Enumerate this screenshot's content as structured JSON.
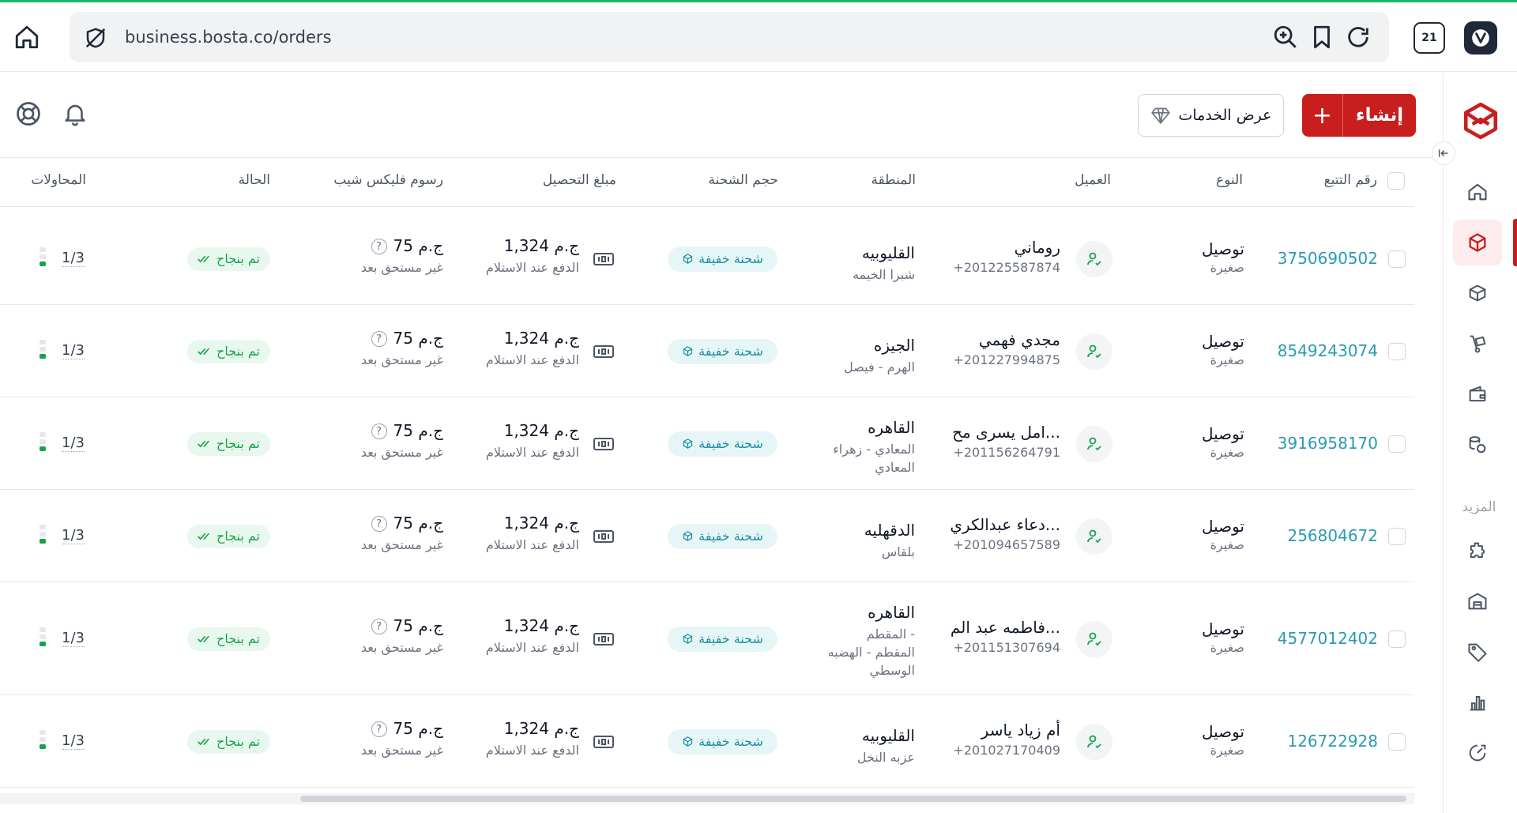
{
  "browser": {
    "url": "business.bosta.co/orders",
    "tabs_count": "21"
  },
  "header": {
    "create_label": "إنشاء",
    "create_plus": "+",
    "services_label": "عرض الخدمات"
  },
  "sidebar": {
    "more_label": "المزيد",
    "items": [
      {
        "icon": "home-icon"
      },
      {
        "icon": "package-icon",
        "active": true
      },
      {
        "icon": "boxes-icon"
      },
      {
        "icon": "hand-truck-icon"
      },
      {
        "icon": "wallet-icon"
      },
      {
        "icon": "coins-icon"
      },
      {
        "icon": "puzzle-icon"
      },
      {
        "icon": "warehouse-icon"
      },
      {
        "icon": "tag-icon"
      },
      {
        "icon": "analytics-icon"
      },
      {
        "icon": "speedometer-icon"
      }
    ]
  },
  "table": {
    "columns": {
      "tracking": "رقم التتبع",
      "type": "النوع",
      "customer": "العميل",
      "region": "المنطقة",
      "size": "حجم الشحنة",
      "cod": "مبلغ التحصيل",
      "fees": "رسوم فليكس شيب",
      "status": "الحالة",
      "attempts": "المحاولات"
    },
    "rows": [
      {
        "tracking": "3750690502",
        "type": "توصيل",
        "type_sub": "صغيرة",
        "name": "روماني",
        "phone": "+201225587874",
        "city": "القليوبيه",
        "area": "شبرا الخيمه",
        "size": "شحنة خفيفة",
        "cod": "1,324 ج.م",
        "cod_sub": "الدفع عند الاستلام",
        "fee": "75 ج.م",
        "fee_sub": "غير مستحق بعد",
        "status": "تم بنجاح",
        "attempts": "1/3"
      },
      {
        "tracking": "8549243074",
        "type": "توصيل",
        "type_sub": "صغيرة",
        "name": "مجدي فهمي",
        "phone": "+201227994875",
        "city": "الجيزه",
        "area": "الهرم - فيصل",
        "size": "شحنة خفيفة",
        "cod": "1,324 ج.م",
        "cod_sub": "الدفع عند الاستلام",
        "fee": "75 ج.م",
        "fee_sub": "غير مستحق بعد",
        "status": "تم بنجاح",
        "attempts": "1/3"
      },
      {
        "tracking": "3916958170",
        "type": "توصيل",
        "type_sub": "صغيرة",
        "name": "امل يسرى مح...",
        "phone": "+201156264791",
        "city": "القاهره",
        "area": "المعادي - زهراء",
        "area2": "المعادي",
        "size": "شحنة خفيفة",
        "cod": "1,324 ج.م",
        "cod_sub": "الدفع عند الاستلام",
        "fee": "75 ج.م",
        "fee_sub": "غير مستحق بعد",
        "status": "تم بنجاح",
        "attempts": "1/3"
      },
      {
        "tracking": "256804672",
        "type": "توصيل",
        "type_sub": "صغيرة",
        "name": "دعاء عبدالكري...",
        "phone": "+201094657589",
        "city": "الدقهليه",
        "area": "بلقاس",
        "size": "شحنة خفيفة",
        "cod": "1,324 ج.م",
        "cod_sub": "الدفع عند الاستلام",
        "fee": "75 ج.م",
        "fee_sub": "غير مستحق بعد",
        "status": "تم بنجاح",
        "attempts": "1/3"
      },
      {
        "tracking": "4577012402",
        "type": "توصيل",
        "type_sub": "صغيرة",
        "name": "فاطمه عبد الم...",
        "phone": "+201151307694",
        "city": "القاهره",
        "area": "المقطم -",
        "area2": "المقطم - الهضبه",
        "area3": "الوسطي",
        "size": "شحنة خفيفة",
        "cod": "1,324 ج.م",
        "cod_sub": "الدفع عند الاستلام",
        "fee": "75 ج.م",
        "fee_sub": "غير مستحق بعد",
        "status": "تم بنجاح",
        "attempts": "1/3"
      },
      {
        "tracking": "126722928",
        "type": "توصيل",
        "type_sub": "صغيرة",
        "name": "أم زياد ياسر",
        "phone": "+201027170409",
        "city": "القليوبيه",
        "area": "عزبه النخل",
        "size": "شحنة خفيفة",
        "cod": "1,324 ج.م",
        "cod_sub": "الدفع عند الاستلام",
        "fee": "75 ج.م",
        "fee_sub": "غير مستحق بعد",
        "status": "تم بنجاح",
        "attempts": "1/3"
      }
    ]
  },
  "colors": {
    "brand_red": "#c81e1e",
    "link_teal": "#2a9bb0",
    "success_green": "#16a34a"
  }
}
